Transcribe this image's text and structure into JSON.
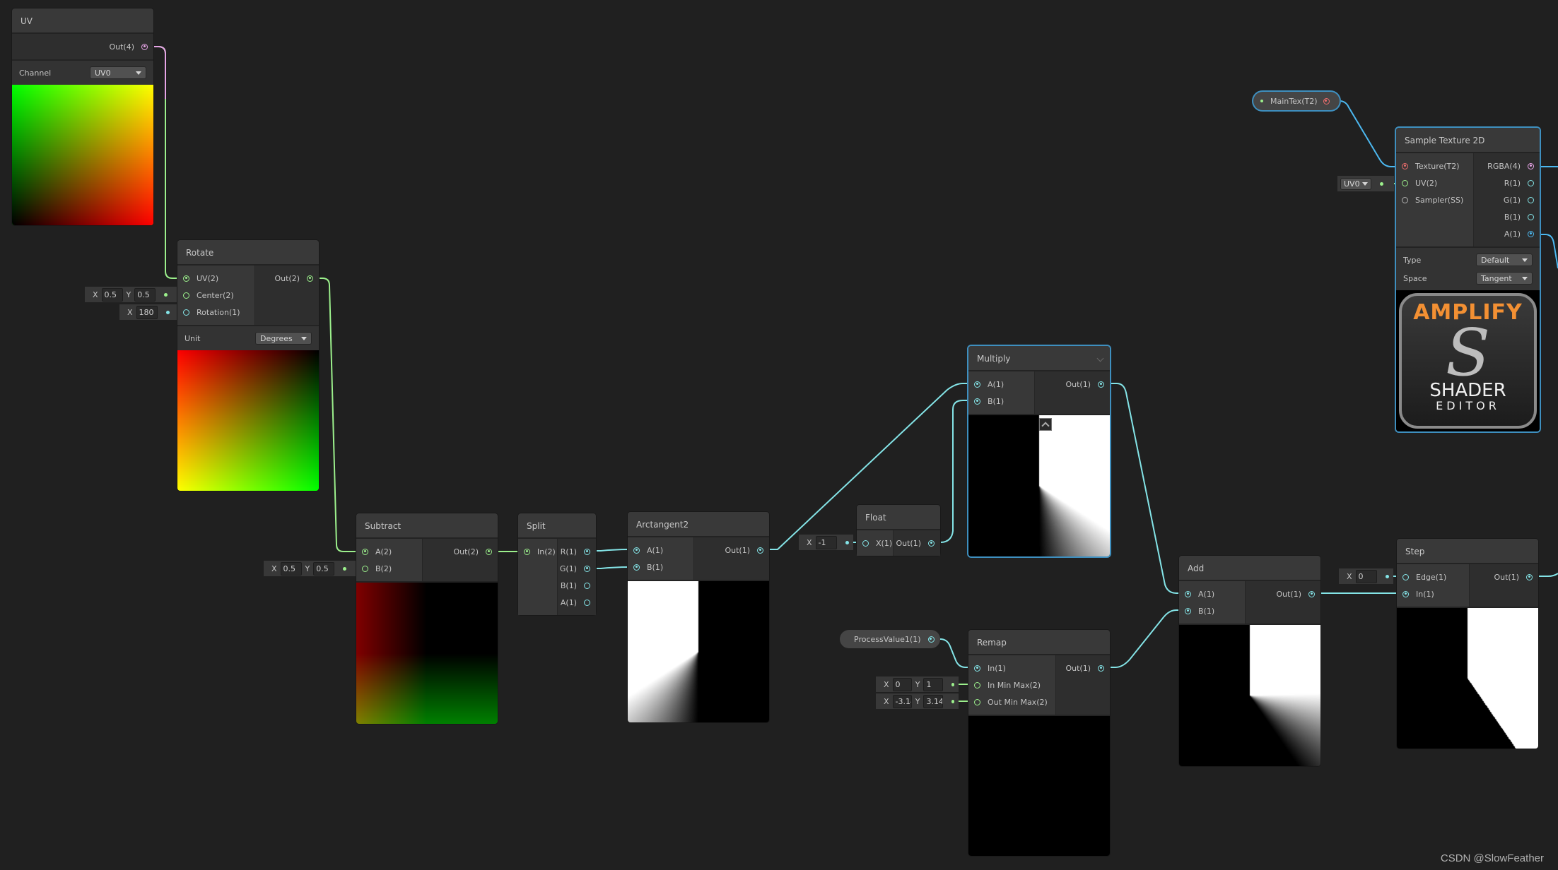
{
  "colors": {
    "background": "#202020",
    "vector1_wire": "#84e4e7",
    "vector2_wire": "#9cf08c",
    "vector4_wire": "#e6a4e6",
    "texture_port": "#ea6c6c",
    "selection": "#3e8fbf"
  },
  "nodes": {
    "uv": {
      "title": "UV",
      "outputs": [
        "Out(4)"
      ],
      "channel_label": "Channel",
      "channel_value": "UV0"
    },
    "rotate": {
      "title": "Rotate",
      "inputs": [
        "UV(2)",
        "Center(2)",
        "Rotation(1)"
      ],
      "outputs": [
        "Out(2)"
      ],
      "unit_label": "Unit",
      "unit_value": "Degrees",
      "center_field": {
        "x_label": "X",
        "x": "0.5",
        "y_label": "Y",
        "y": "0.5"
      },
      "rotation_field": {
        "x_label": "X",
        "x": "180"
      }
    },
    "subtract": {
      "title": "Subtract",
      "inputs": [
        "A(2)",
        "B(2)"
      ],
      "outputs": [
        "Out(2)"
      ],
      "b_field": {
        "x_label": "X",
        "x": "0.5",
        "y_label": "Y",
        "y": "0.5"
      }
    },
    "split": {
      "title": "Split",
      "inputs": [
        "In(2)"
      ],
      "outputs": [
        "R(1)",
        "G(1)",
        "B(1)",
        "A(1)"
      ]
    },
    "arctangent2": {
      "title": "Arctangent2",
      "inputs": [
        "A(1)",
        "B(1)"
      ],
      "outputs": [
        "Out(1)"
      ]
    },
    "float": {
      "title": "Float",
      "inputs": [
        "X(1)"
      ],
      "outputs": [
        "Out(1)"
      ],
      "x_field": {
        "x_label": "X",
        "x": "-1"
      }
    },
    "multiply": {
      "title": "Multiply",
      "inputs": [
        "A(1)",
        "B(1)"
      ],
      "outputs": [
        "Out(1)"
      ]
    },
    "remap": {
      "title": "Remap",
      "inputs": [
        "In(1)",
        "In Min Max(2)",
        "Out Min Max(2)"
      ],
      "outputs": [
        "Out(1)"
      ],
      "in_min_max": {
        "x_label": "X",
        "x": "0",
        "y_label": "Y",
        "y": "1"
      },
      "out_min_max": {
        "x_label": "X",
        "x": "-3.14",
        "y_label": "Y",
        "y": "3.14"
      }
    },
    "process_value": {
      "label": "ProcessValue1(1)"
    },
    "add": {
      "title": "Add",
      "inputs": [
        "A(1)",
        "B(1)"
      ],
      "outputs": [
        "Out(1)"
      ]
    },
    "step": {
      "title": "Step",
      "inputs": [
        "Edge(1)",
        "In(1)"
      ],
      "outputs": [
        "Out(1)"
      ],
      "edge_field": {
        "x_label": "X",
        "x": "0"
      }
    },
    "main_tex": {
      "label": "MainTex(T2)"
    },
    "sample_texture_2d": {
      "title": "Sample Texture 2D",
      "inputs": [
        "Texture(T2)",
        "UV(2)",
        "Sampler(SS)"
      ],
      "outputs": [
        "RGBA(4)",
        "R(1)",
        "G(1)",
        "B(1)",
        "A(1)"
      ],
      "uv_dropdown": "UV0",
      "type_label": "Type",
      "type_value": "Default",
      "space_label": "Space",
      "space_value": "Tangent",
      "logo": {
        "line1": "AMPLIFY",
        "glyph": "S",
        "line2": "SHADER",
        "line3": "EDITOR"
      }
    }
  },
  "watermark": "CSDN @SlowFeather"
}
